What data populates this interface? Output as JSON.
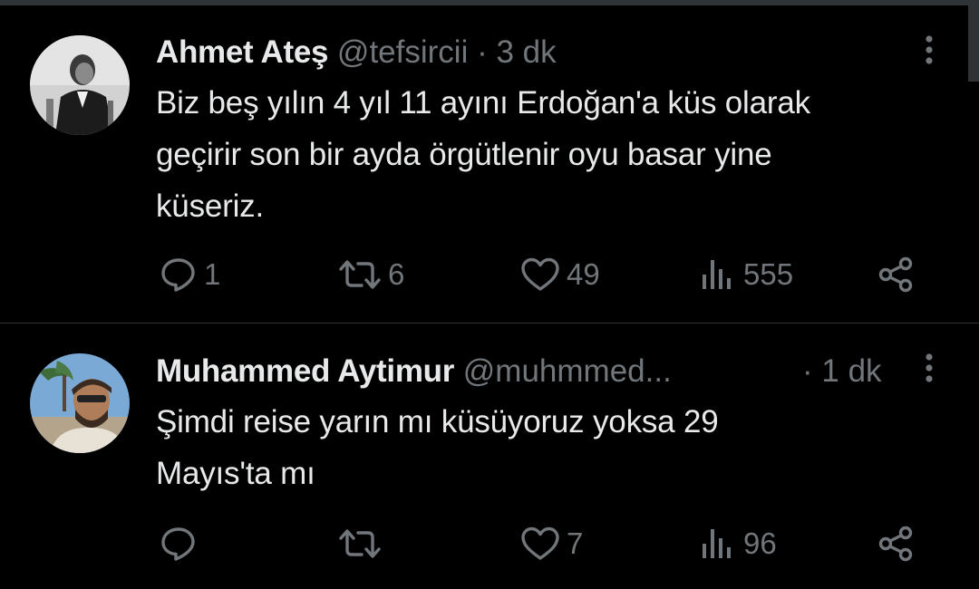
{
  "tweets": [
    {
      "name": "Ahmet Ateş",
      "handle": "@tefsircii",
      "dot": "·",
      "time": "3 dk",
      "text_lines": [
        "Biz beş yılın 4 yıl 11 ayını Erdoğan'a küs olarak",
        "geçirir son bir ayda örgütlenir oyu basar yine",
        "küseriz."
      ],
      "actions": {
        "replies": "1",
        "retweets": "6",
        "likes": "49",
        "views": "555"
      }
    },
    {
      "name": "Muhammed Aytimur",
      "handle": "@muhmmed...",
      "dot": "·",
      "time": "1 dk",
      "text_lines": [
        "Şimdi reise yarın mı küsüyoruz yoksa 29",
        "Mayıs'ta mı"
      ],
      "actions": {
        "replies": "",
        "retweets": "",
        "likes": "7",
        "views": "96"
      }
    }
  ],
  "icons": {
    "reply": "reply-icon",
    "retweet": "retweet-icon",
    "like": "heart-icon",
    "views": "views-icon",
    "share": "share-icon",
    "more": "more-icon"
  },
  "colors": {
    "background": "#000000",
    "text": "#e7e9ea",
    "muted": "#71767b",
    "divider": "#2f3336"
  }
}
